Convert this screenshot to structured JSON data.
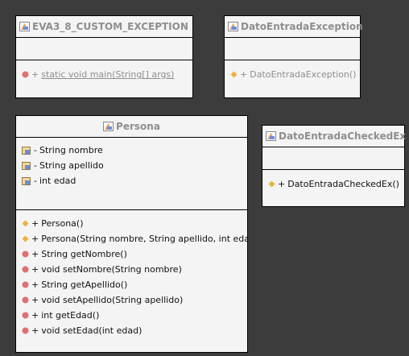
{
  "classes": {
    "main": {
      "name": "EVA3_8_CUSTOM_EXCEPTION",
      "methods": [
        {
          "visibility": "+",
          "text": "static void main(String[] args)",
          "icon": "method-icon"
        }
      ]
    },
    "dato_entrada_exception": {
      "name": "DatoEntradaException",
      "methods": [
        {
          "visibility": "+",
          "text": "DatoEntradaException()",
          "icon": "constructor-icon"
        }
      ]
    },
    "persona": {
      "name": "Persona",
      "fields": [
        {
          "visibility": "-",
          "text": "String nombre",
          "icon": "field-icon"
        },
        {
          "visibility": "-",
          "text": "String apellido",
          "icon": "field-icon"
        },
        {
          "visibility": "-",
          "text": "int edad",
          "icon": "field-icon"
        }
      ],
      "methods": [
        {
          "visibility": "+",
          "text": "Persona()",
          "icon": "constructor-icon"
        },
        {
          "visibility": "+",
          "text": "Persona(String nombre, String apellido, int edad)",
          "icon": "constructor-icon"
        },
        {
          "visibility": "+",
          "text": "String getNombre()",
          "icon": "method-icon"
        },
        {
          "visibility": "+",
          "text": "void setNombre(String nombre)",
          "icon": "method-icon"
        },
        {
          "visibility": "+",
          "text": "String getApellido()",
          "icon": "method-icon"
        },
        {
          "visibility": "+",
          "text": "void setApellido(String apellido)",
          "icon": "method-icon"
        },
        {
          "visibility": "+",
          "text": "int getEdad()",
          "icon": "method-icon"
        },
        {
          "visibility": "+",
          "text": "void setEdad(int edad)",
          "icon": "method-icon"
        }
      ]
    },
    "dato_entrada_checked": {
      "name": "DatoEntradaCheckedEx",
      "methods": [
        {
          "visibility": "+",
          "text": "DatoEntradaCheckedEx()",
          "icon": "constructor-icon"
        }
      ]
    }
  },
  "colors": {
    "background": "#3c3c3c",
    "box": "#f4f4f4",
    "constructor_icon": "#f0b040",
    "method_icon": "#e07070"
  }
}
